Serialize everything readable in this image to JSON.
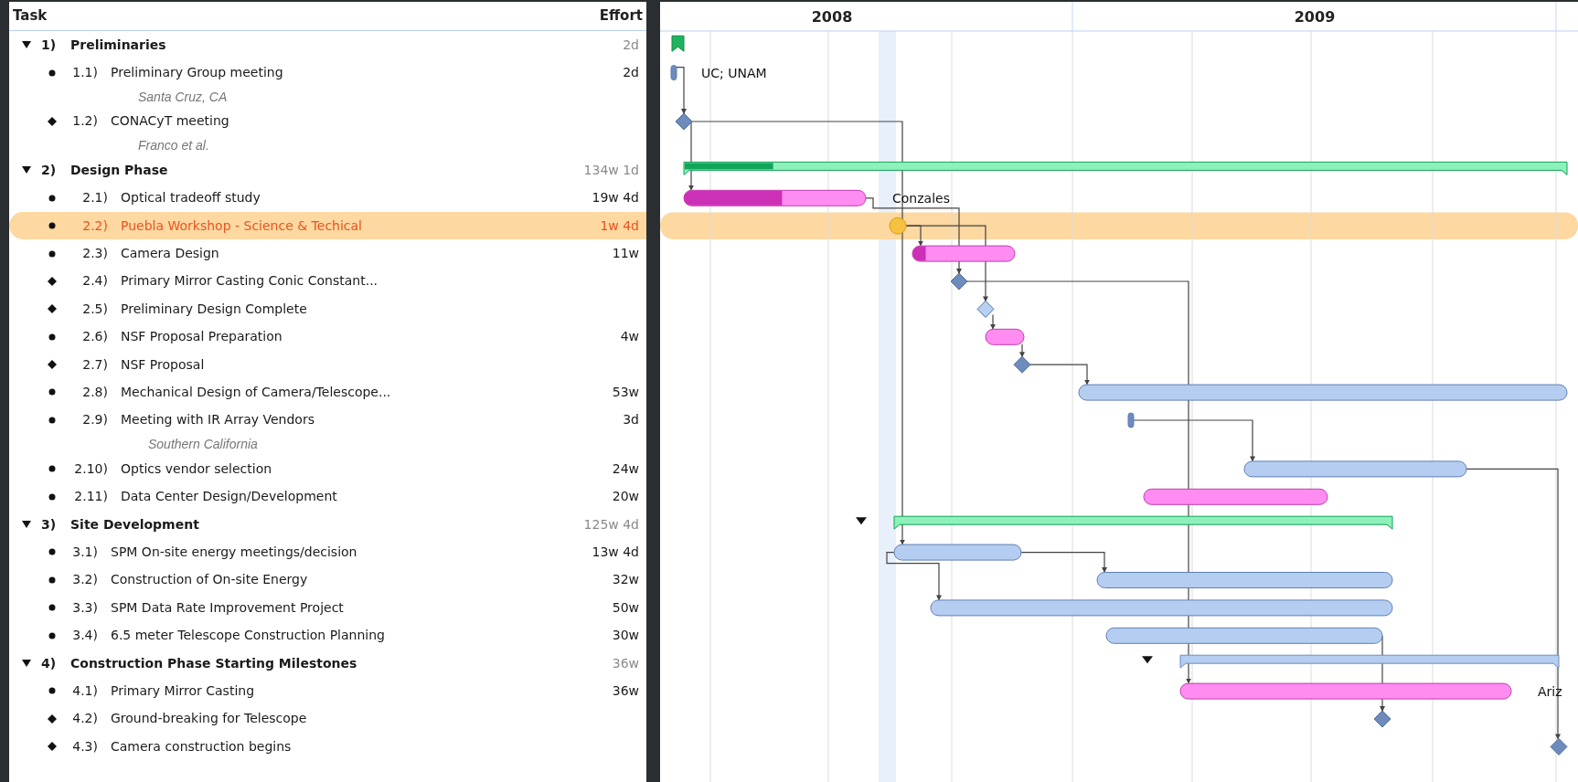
{
  "columns": {
    "task": "Task",
    "effort": "Effort"
  },
  "timeline": {
    "years": [
      "2008",
      "2009"
    ]
  },
  "rows": [
    {
      "kind": "group",
      "number": "1)",
      "title": "Preliminaries",
      "effort": "2d",
      "expanded": true,
      "selected": false,
      "color": "#1fb35f",
      "children": [
        {
          "kind": "task",
          "number": "1.1)",
          "title": "Preliminary Group meeting",
          "effort": "2d",
          "note": "Santa Cruz, CA",
          "selected": false,
          "color": "#6d8bbb",
          "chart_label": "UC; UNAM"
        },
        {
          "kind": "milestone",
          "number": "1.2)",
          "title": "CONACyT meeting",
          "note": "Franco et al.",
          "selected": false,
          "color": "#6d8bbb"
        }
      ]
    },
    {
      "kind": "group",
      "number": "2)",
      "title": "Design Phase",
      "effort": "134w 1d",
      "expanded": true,
      "selected": false,
      "color": "#8ef0bb",
      "level": 0.1,
      "children": [
        {
          "kind": "task",
          "number": "2.1)",
          "title": "Optical tradeoff study",
          "effort": "19w 4d",
          "selected": false,
          "color": "#ff8cf0",
          "level": 0.54,
          "chart_label": "Conzales"
        },
        {
          "kind": "task",
          "number": "2.2)",
          "title": "Puebla Workshop - Science & Techical",
          "effort": "1w 4d",
          "selected": true,
          "color": "#f6c040"
        },
        {
          "kind": "task",
          "number": "2.3)",
          "title": "Camera Design",
          "effort": "11w",
          "selected": false,
          "color": "#ff8cf0",
          "level": 0.13
        },
        {
          "kind": "milestone",
          "number": "2.4)",
          "title": "Primary Mirror Casting Conic Constant...",
          "selected": false,
          "color": "#6d8bbb"
        },
        {
          "kind": "milestone",
          "number": "2.5)",
          "title": "Preliminary Design Complete",
          "selected": false,
          "color": "#b8d0f2"
        },
        {
          "kind": "task",
          "number": "2.6)",
          "title": "NSF Proposal Preparation",
          "effort": "4w",
          "selected": false,
          "color": "#ff8cf0"
        },
        {
          "kind": "milestone",
          "number": "2.7)",
          "title": "NSF Proposal",
          "selected": false,
          "color": "#6d8bbb"
        },
        {
          "kind": "task",
          "number": "2.8)",
          "title": "Mechanical Design of Camera/Telescope...",
          "effort": "53w",
          "selected": false,
          "color": "#b5cdf0"
        },
        {
          "kind": "task",
          "number": "2.9)",
          "title": "Meeting with IR Array Vendors",
          "effort": "3d",
          "note": "Southern California",
          "selected": false,
          "color": "#6d8bbb"
        },
        {
          "kind": "task",
          "number": "2.10)",
          "title": "Optics vendor selection",
          "effort": "24w",
          "selected": false,
          "color": "#b5cdf0"
        },
        {
          "kind": "task",
          "number": "2.11)",
          "title": "Data Center Design/Development",
          "effort": "20w",
          "selected": false,
          "color": "#ff8cf0"
        }
      ]
    },
    {
      "kind": "group",
      "number": "3)",
      "title": "Site Development",
      "effort": "125w 4d",
      "expanded": true,
      "selected": false,
      "color": "#8ef0bb",
      "children": [
        {
          "kind": "task",
          "number": "3.1)",
          "title": "SPM On-site energy meetings/decision",
          "effort": "13w 4d",
          "selected": false,
          "color": "#b5cdf0"
        },
        {
          "kind": "task",
          "number": "3.2)",
          "title": "Construction of On-site Energy",
          "effort": "32w",
          "selected": false,
          "color": "#b5cdf0"
        },
        {
          "kind": "task",
          "number": "3.3)",
          "title": "SPM Data Rate Improvement Project",
          "effort": "50w",
          "selected": false,
          "color": "#b5cdf0"
        },
        {
          "kind": "task",
          "number": "3.4)",
          "title": "6.5 meter Telescope Construction Planning",
          "effort": "30w",
          "selected": false,
          "color": "#b5cdf0"
        }
      ]
    },
    {
      "kind": "group",
      "number": "4)",
      "title": "Construction Phase Starting Milestones",
      "effort": "36w",
      "expanded": true,
      "selected": false,
      "color": "#b5cdf0",
      "children": [
        {
          "kind": "task",
          "number": "4.1)",
          "title": "Primary Mirror Casting",
          "effort": "36w",
          "selected": false,
          "color": "#ff8cf0",
          "chart_label": "Ariz"
        },
        {
          "kind": "milestone",
          "number": "4.2)",
          "title": "Ground-breaking for Telescope",
          "selected": false,
          "color": "#6d8bbb"
        },
        {
          "kind": "milestone",
          "number": "4.3)",
          "title": "Camera construction begins",
          "selected": false,
          "color": "#6d8bbb"
        }
      ]
    }
  ]
}
